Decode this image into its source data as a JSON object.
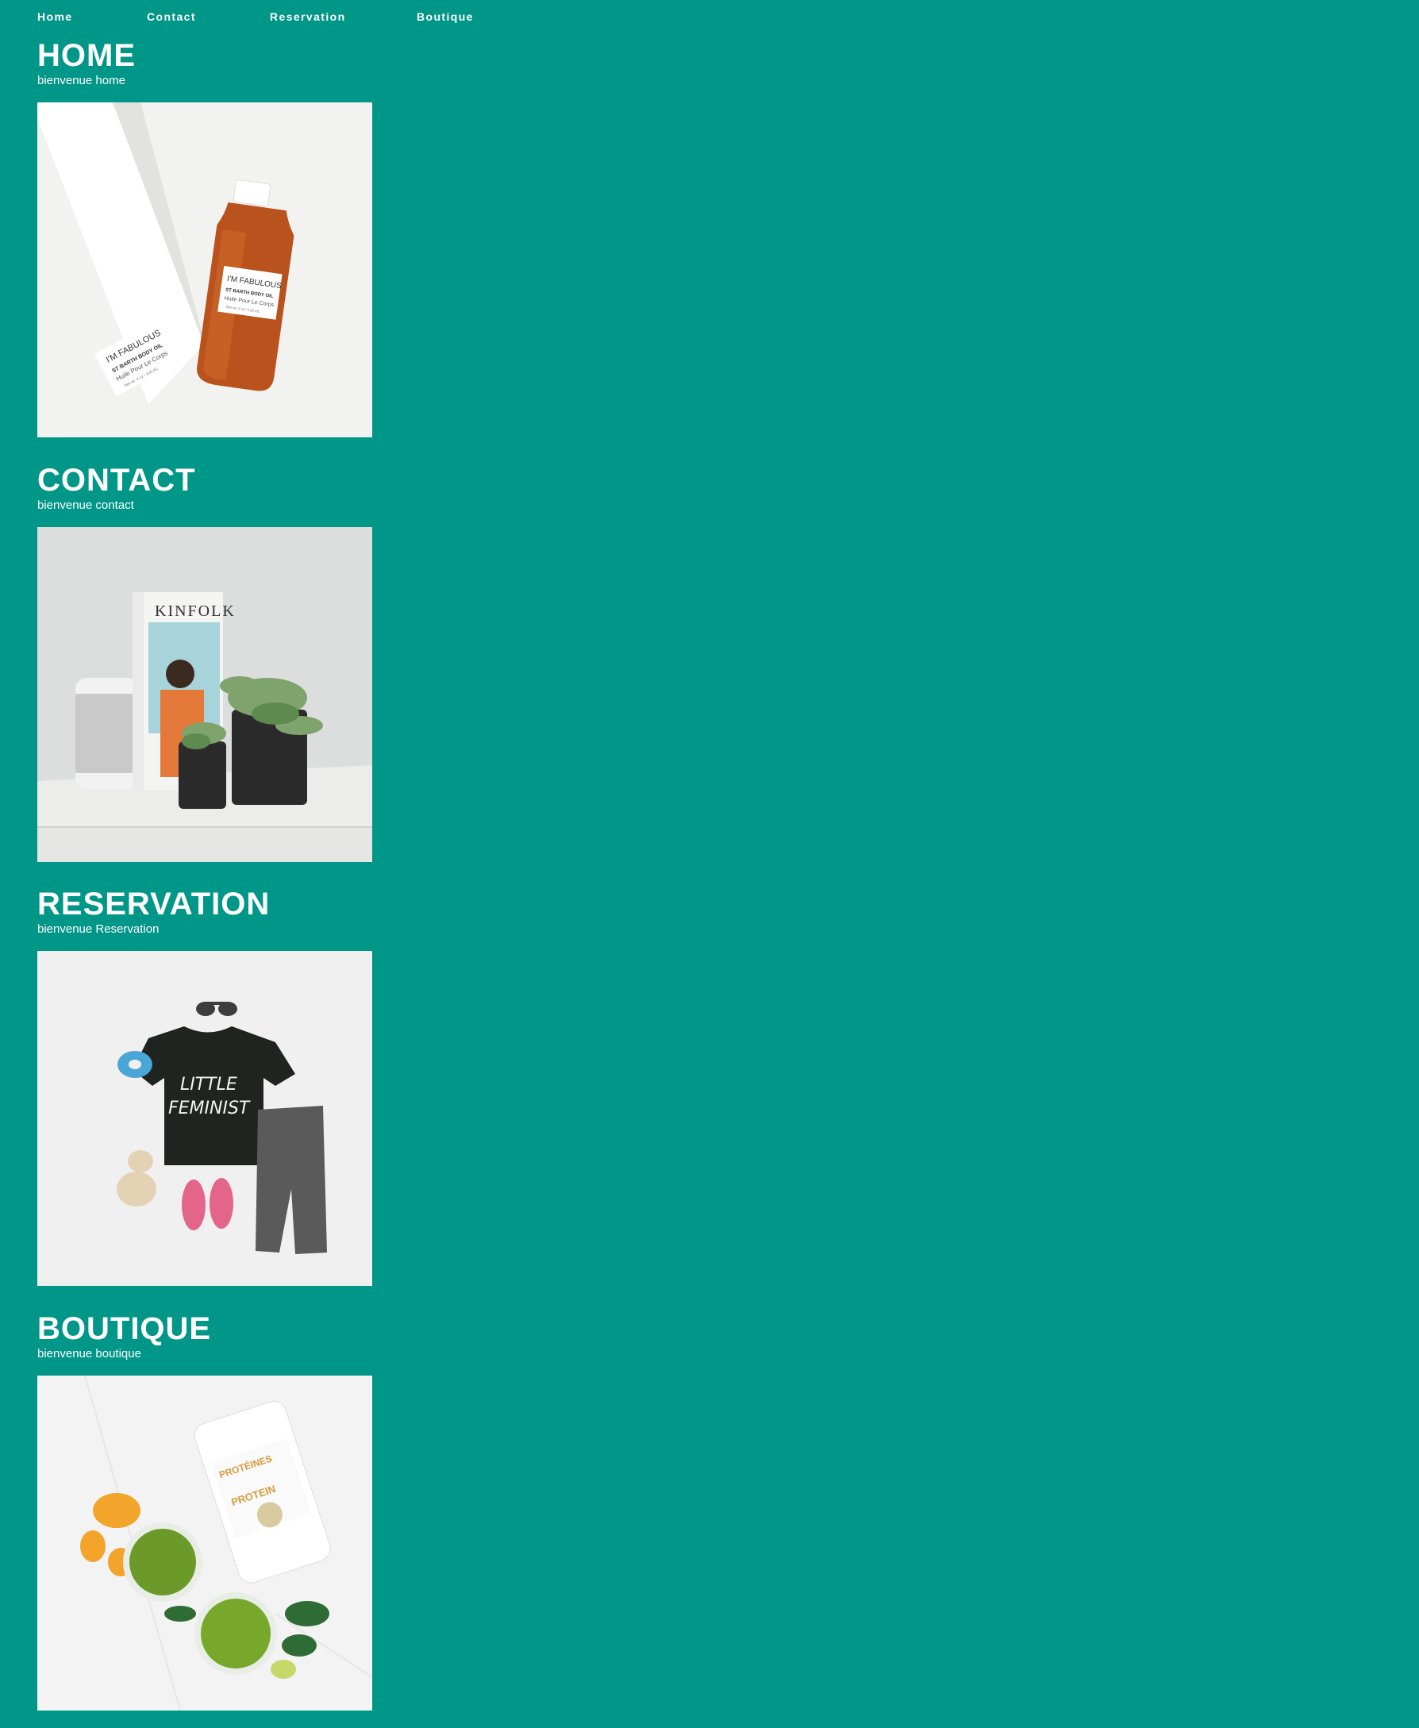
{
  "nav": {
    "items": [
      {
        "label": "Home"
      },
      {
        "label": "Contact"
      },
      {
        "label": "Reservation"
      },
      {
        "label": "Boutique"
      }
    ]
  },
  "sections": [
    {
      "title": "HOME",
      "subtitle": "bienvenue home",
      "image": {
        "label_line1": "I'M FABULOUS",
        "label_line2": "ST BARTH BODY OIL",
        "label_line3": "Huile Pour Le Corps",
        "label_line4": "Net wt. 4 oz / 120 mL"
      }
    },
    {
      "title": "CONTACT",
      "subtitle": "bienvenue contact",
      "image": {
        "magazine_title": "KINFOLK"
      }
    },
    {
      "title": "RESERVATION",
      "subtitle": "bienvenue Reservation",
      "image": {
        "shirt_text_line1": "LITTLE",
        "shirt_text_line2": "FEMINIST"
      }
    },
    {
      "title": "BOUTIQUE",
      "subtitle": "bienvenue boutique",
      "image": {
        "tub_text_line1": "PROTÉINES",
        "tub_text_line2": "PROTEIN"
      }
    }
  ],
  "colors": {
    "background": "#009688",
    "text": "#ffffff"
  }
}
